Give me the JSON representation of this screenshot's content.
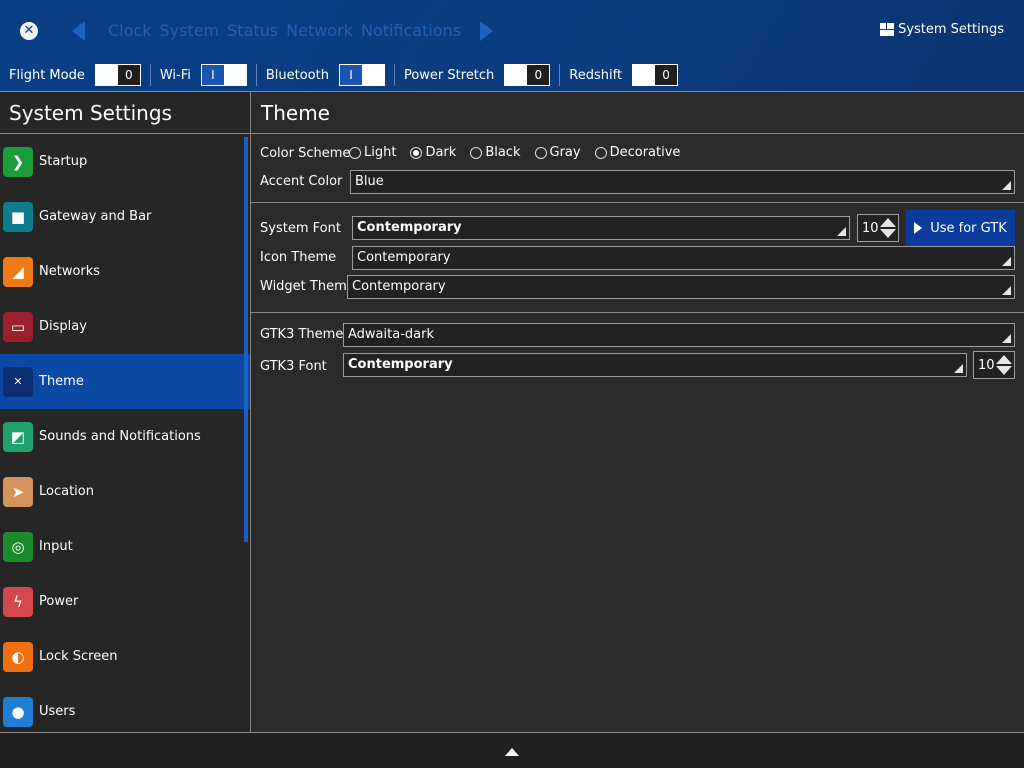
{
  "header": {
    "close_icon": "✕",
    "tabs": [
      "Clock",
      "System",
      "Status",
      "Network",
      "Notifications"
    ],
    "app_title": "System Settings"
  },
  "quick_settings": [
    {
      "label": "Flight Mode",
      "state": "off",
      "text": "0"
    },
    {
      "label": "Wi-Fi",
      "state": "on",
      "text": "I"
    },
    {
      "label": "Bluetooth",
      "state": "on",
      "text": "I"
    },
    {
      "label": "Power Stretch",
      "state": "off",
      "text": "0"
    },
    {
      "label": "Redshift",
      "state": "off",
      "text": "0"
    }
  ],
  "sidebar": {
    "title": "System Settings",
    "items": [
      {
        "label": "Startup",
        "icon": "startup-icon",
        "color": "#1b9b3a",
        "glyph": "❯"
      },
      {
        "label": "Gateway and Bar",
        "icon": "gateway-icon",
        "color": "#0e7d8b",
        "glyph": "■"
      },
      {
        "label": "Networks",
        "icon": "networks-icon",
        "color": "#f07a16",
        "glyph": "◢"
      },
      {
        "label": "Display",
        "icon": "display-icon",
        "color": "#9c1f2e",
        "glyph": "▭"
      },
      {
        "label": "Theme",
        "icon": "theme-icon",
        "color": "#0a2d74",
        "glyph": "✕"
      },
      {
        "label": "Sounds and Notifications",
        "icon": "sounds-icon",
        "color": "#22a06b",
        "glyph": "◩"
      },
      {
        "label": "Location",
        "icon": "location-icon",
        "color": "#d3935a",
        "glyph": "➤"
      },
      {
        "label": "Input",
        "icon": "input-icon",
        "color": "#1e8a2e",
        "glyph": "◎"
      },
      {
        "label": "Power",
        "icon": "power-icon",
        "color": "#d4474c",
        "glyph": "ϟ"
      },
      {
        "label": "Lock Screen",
        "icon": "lock-icon",
        "color": "#f06f12",
        "glyph": "◐"
      },
      {
        "label": "Users",
        "icon": "users-icon",
        "color": "#1f7fd6",
        "glyph": "●"
      }
    ],
    "selected_index": 4
  },
  "main": {
    "title": "Theme",
    "color_scheme": {
      "label": "Color Scheme",
      "options": [
        "Light",
        "Dark",
        "Black",
        "Gray",
        "Decorative"
      ],
      "selected": "Dark"
    },
    "accent_color": {
      "label": "Accent Color",
      "value": "Blue"
    },
    "system_font": {
      "label": "System Font",
      "value": "Contemporary",
      "size": "10",
      "button": "Use for GTK"
    },
    "icon_theme": {
      "label": "Icon Theme",
      "value": "Contemporary"
    },
    "widget_theme": {
      "label": "Widget Theme",
      "value": "Contemporary"
    },
    "gtk3_theme": {
      "label": "GTK3 Theme",
      "value": "Adwaita-dark"
    },
    "gtk3_font": {
      "label": "GTK3 Font",
      "value": "Contemporary",
      "size": "10"
    }
  },
  "colors": {
    "header_bg": "#0b3c7d",
    "selected_bg": "#0b49a4",
    "button_bg": "#0b3c9b",
    "panel_bg": "#2b2b2b"
  }
}
